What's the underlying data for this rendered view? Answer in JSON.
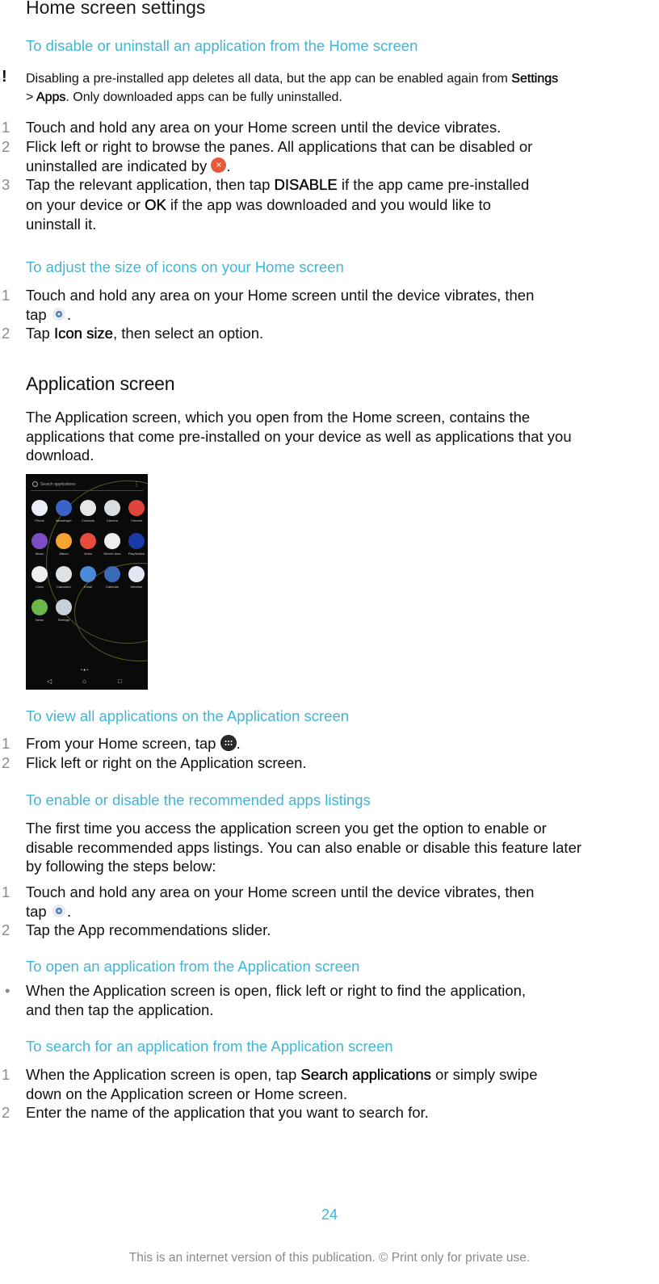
{
  "page": {
    "title": "Home screen settings",
    "sections": {
      "disable": {
        "heading": "To disable or uninstall an application from the Home screen",
        "note": {
          "icon": "exclamation-icon",
          "text_a": "Disabling a pre-installed app deletes all data, but the app can be enabled again from ",
          "link_settings": "Settings",
          "text_b": "> ",
          "link_apps": "Apps",
          "text_c": ". Only downloaded apps can be fully uninstalled."
        },
        "steps": [
          {
            "num": "1",
            "text": "Touch and hold any area on your Home screen until the device vibrates."
          },
          {
            "num": "2",
            "line1": "Flick left or right to browse the panes. All applications that can be disabled or",
            "line2": "uninstalled are indicated by ",
            "icon": "close-x-icon",
            "icon_glyph": "×",
            "end": "."
          },
          {
            "num": "3",
            "line1a": "Tap the relevant application, then tap ",
            "bold1": "DISABLE",
            "line1b": " if the app came pre-installed",
            "line2a": "on your device or ",
            "bold2": "OK",
            "line2b": " if the app was downloaded and you would like to",
            "line3": "uninstall it."
          }
        ]
      },
      "icon_size": {
        "heading": "To adjust the size of icons on your Home screen",
        "steps": [
          {
            "num": "1",
            "line1": "Touch and hold any area on your Home screen until the device vibrates, then",
            "line2": "tap ",
            "icon": "gear-icon",
            "end": "."
          },
          {
            "num": "2",
            "text_a": "Tap ",
            "bold": "Icon size",
            "text_b": ", then select an option."
          }
        ]
      },
      "app_screen": {
        "heading": "Application screen",
        "intro": [
          "The Application screen, which you open from the Home screen, contains the",
          "applications that come pre-installed on your device as well as applications that you",
          "download."
        ],
        "screenshot": {
          "search_placeholder": "Search applications",
          "more_glyph": "⋮",
          "apps": [
            {
              "label": "Phone",
              "color": "#e8eef5"
            },
            {
              "label": "Messenger",
              "color": "#3a64c8"
            },
            {
              "label": "Contacts",
              "color": "#e6e6e6"
            },
            {
              "label": "Camera",
              "color": "#d8dde2"
            },
            {
              "label": "Chrome",
              "color": "#e0453a"
            },
            {
              "label": "Music",
              "color": "#7a4fc6"
            },
            {
              "label": "Album",
              "color": "#f3a530"
            },
            {
              "label": "Video",
              "color": "#e84a3c"
            },
            {
              "label": "What's New",
              "color": "#eeeeee"
            },
            {
              "label": "PlayStation",
              "color": "#1a3aa8"
            },
            {
              "label": "Clock",
              "color": "#eeeeee"
            },
            {
              "label": "Calculator",
              "color": "#dde2e6"
            },
            {
              "label": "Email",
              "color": "#4a8ad8"
            },
            {
              "label": "Calendar",
              "color": "#3a6ab8"
            },
            {
              "label": "Weather",
              "color": "#dfe8f2"
            },
            {
              "label": "News",
              "color": "#6cb84a"
            },
            {
              "label": "Settings",
              "color": "#c8d0d8"
            }
          ],
          "pager": "• ● •",
          "nav_back": "◁",
          "nav_home": "⌂",
          "nav_recent": "□"
        }
      },
      "view_all": {
        "heading": "To view all applications on the Application screen",
        "steps": [
          {
            "num": "1",
            "text_a": "From your Home screen, tap ",
            "icon": "app-grid-icon",
            "end": "."
          },
          {
            "num": "2",
            "text": "Flick left or right on the Application screen."
          }
        ]
      },
      "recommended": {
        "heading": "To enable or disable the recommended apps listings",
        "intro": [
          "The first time you access the application screen you get the option to enable or",
          "disable recommended apps listings. You can also enable or disable this feature later",
          "by following the steps below:"
        ],
        "steps": [
          {
            "num": "1",
            "line1": "Touch and hold any area on your Home screen until the device vibrates, then",
            "line2": "tap ",
            "icon": "gear-icon",
            "end": "."
          },
          {
            "num": "2",
            "text": "Tap the App recommendations slider."
          }
        ]
      },
      "open_app": {
        "heading": "To open an application from the Application screen",
        "bullet": "•",
        "lines": [
          "When the Application screen is open, flick left or right to find the application,",
          "and then tap the application."
        ]
      },
      "search_app": {
        "heading": "To search for an application from the Application screen",
        "steps": [
          {
            "num": "1",
            "line1a": "When the Application screen is open, tap ",
            "bold": "Search applications",
            "line1b": " or simply swipe",
            "line2": "down on the Application screen or Home screen."
          },
          {
            "num": "2",
            "text": "Enter the name of the application that you want to search for."
          }
        ]
      }
    },
    "page_number": "24",
    "footer": "This is an internet version of this publication. © Print only for private use.",
    "colors": {
      "accent": "#3fb5d8",
      "step_number": "#8a8a8a",
      "close_badge": "#e8593a"
    }
  }
}
